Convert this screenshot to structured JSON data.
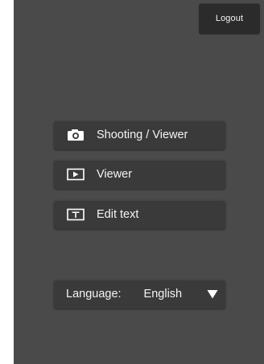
{
  "header": {
    "logout_label": "Logout"
  },
  "menu": {
    "shooting_viewer_label": "Shooting / Viewer",
    "viewer_label": "Viewer",
    "edit_text_label": "Edit text"
  },
  "language": {
    "label": "Language:",
    "value": "English"
  },
  "icons": {
    "shooting": "camera-icon",
    "viewer": "play-icon",
    "edit": "text-t-icon",
    "language_dropdown": "triangle-down-icon"
  },
  "colors": {
    "background": "#4a4a4a",
    "button": "#3a3a3a",
    "logout_button": "#2b2b2b",
    "text": "#ffffff"
  }
}
